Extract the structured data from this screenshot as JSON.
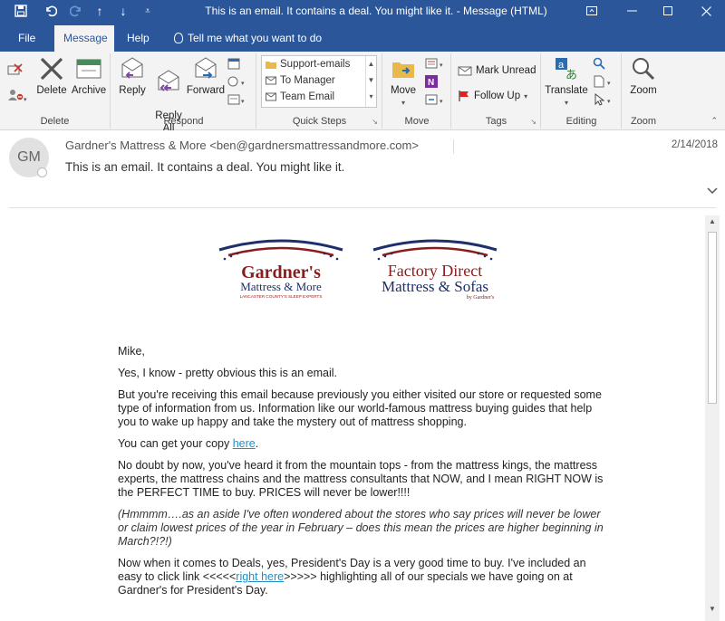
{
  "window": {
    "title": "This is an email. It contains a deal. You might like it.  -  Message (HTML)"
  },
  "tabs": [
    {
      "label": "File"
    },
    {
      "label": "Message"
    },
    {
      "label": "Help"
    },
    {
      "label": "Tell me what you want to do"
    }
  ],
  "ribbon": {
    "delete_group": {
      "label": "Delete",
      "delete": "Delete",
      "archive": "Archive"
    },
    "respond_group": {
      "label": "Respond",
      "reply": "Reply",
      "reply_all": "Reply\nAll",
      "forward": "Forward"
    },
    "quick_steps_group": {
      "label": "Quick Steps",
      "items": [
        "Support-emails",
        "To Manager",
        "Team Email"
      ]
    },
    "move_group": {
      "label": "Move",
      "move": "Move"
    },
    "tags_group": {
      "label": "Tags",
      "mark_unread": "Mark Unread",
      "follow_up": "Follow Up"
    },
    "editing_group": {
      "label": "Editing",
      "translate": "Translate"
    },
    "zoom_group": {
      "label": "Zoom",
      "zoom": "Zoom"
    }
  },
  "message": {
    "avatar_initials": "GM",
    "sender": "Gardner's Mattress & More <ben@gardnersmattressandmore.com>",
    "subject": "This is an email. It contains a deal. You might like it.",
    "date": "2/14/2018"
  },
  "logos": {
    "left": {
      "line1": "Gardner's",
      "line2": "Mattress & More",
      "line3": "LANCASTER COUNTY'S SLEEP EXPERTS"
    },
    "right": {
      "line1": "Factory Direct",
      "line2": "Mattress & Sofas",
      "line3": "by Gardner's"
    }
  },
  "email_body": {
    "greeting": "Mike,",
    "p1": "Yes, I know - pretty obvious this is an email.",
    "p2": "But you're receiving this email because previously you either visited our store or requested some type of information from us. Information like our world-famous mattress buying guides that help you to wake up happy and take the mystery out of mattress shopping.",
    "p3_before": "You can get your copy ",
    "p3_link": "here",
    "p3_after": ".",
    "p4": "No doubt by now, you've heard it from the mountain tops - from the mattress kings, the mattress experts, the mattress chains and the mattress consultants that NOW, and I mean RIGHT NOW is the PERFECT TIME to buy. PRICES will never be lower!!!!",
    "p5": "(Hmmmm….as an aside I've often wondered about the stores who say prices will never be lower or claim lowest prices of the year in February – does this mean the prices are higher beginning in March?!?!)",
    "p6_before": "Now when it comes to Deals, yes, President's Day is a very good time to buy. I've included an easy to click link <<<<<",
    "p6_link": "right here",
    "p6_after": ">>>>> highlighting all of our specials we have going on at Gardner's for President's Day."
  },
  "colors": {
    "titlebar": "#2b579a",
    "ribbon": "#f3f3f3",
    "link": "#1f8fc6",
    "logo_red": "#8b1c1c",
    "logo_navy": "#1f2f6b"
  }
}
